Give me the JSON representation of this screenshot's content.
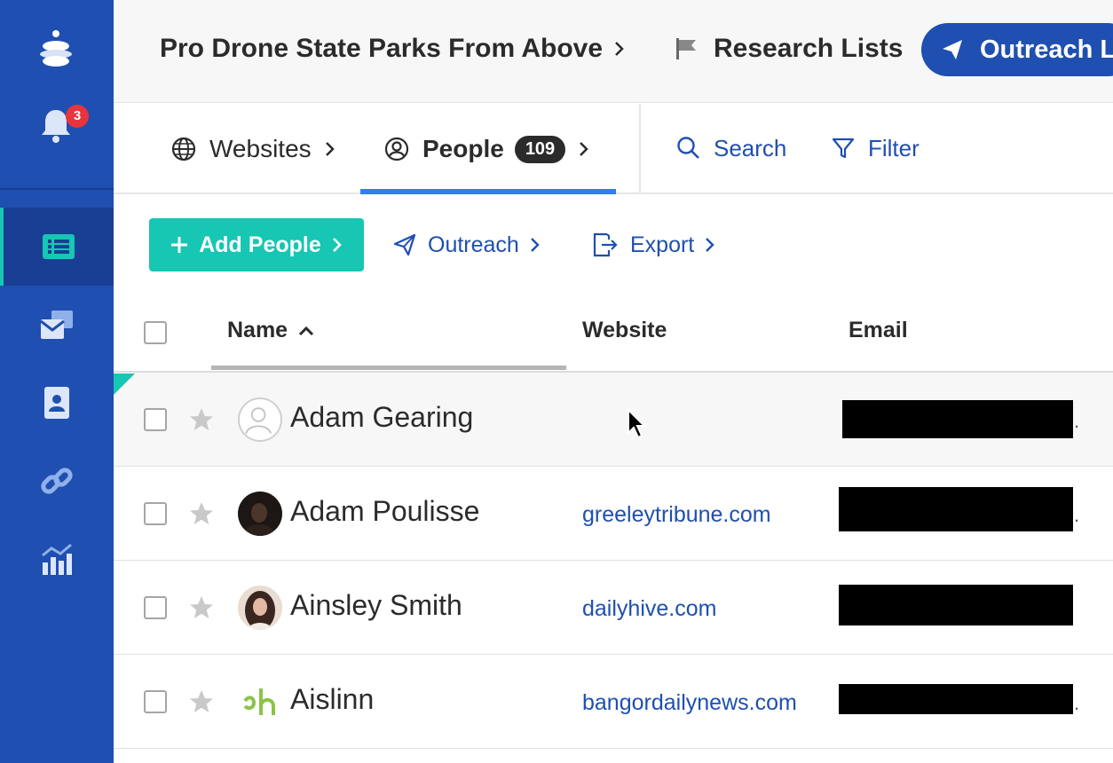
{
  "sidebar": {
    "notification_count": "3",
    "items": [
      {
        "icon": "list-icon",
        "active": true
      },
      {
        "icon": "mail-stack-icon",
        "active": false
      },
      {
        "icon": "contact-card-icon",
        "active": false
      },
      {
        "icon": "link-icon",
        "active": false
      },
      {
        "icon": "analytics-icon",
        "active": false
      }
    ]
  },
  "header": {
    "project_title": "Pro Drone State Parks From Above",
    "research_lists_label": "Research Lists",
    "outreach_button_label": "Outreach L"
  },
  "tabs": {
    "websites_label": "Websites",
    "people_label": "People",
    "people_count": "109",
    "search_label": "Search",
    "filter_label": "Filter"
  },
  "actions": {
    "add_people_label": "Add People",
    "outreach_label": "Outreach",
    "export_label": "Export"
  },
  "table": {
    "columns": {
      "name": "Name",
      "website": "Website",
      "email": "Email"
    },
    "rows": [
      {
        "name": "Adam Gearing",
        "website": "",
        "email_dot": "."
      },
      {
        "name": "Adam Poulisse",
        "website": "greeleytribune.com",
        "email_dot": "."
      },
      {
        "name": "Ainsley Smith",
        "website": "dailyhive.com",
        "email_dot": ""
      },
      {
        "name": "Aislinn",
        "website": "bangordailynews.com",
        "email_dot": "."
      }
    ]
  },
  "colors": {
    "sidebar": "#1f4fb0",
    "accent_teal": "#17c6b3",
    "link_blue": "#1f4fb0",
    "tab_underline": "#2f7ff0",
    "badge_red": "#e8343f"
  }
}
